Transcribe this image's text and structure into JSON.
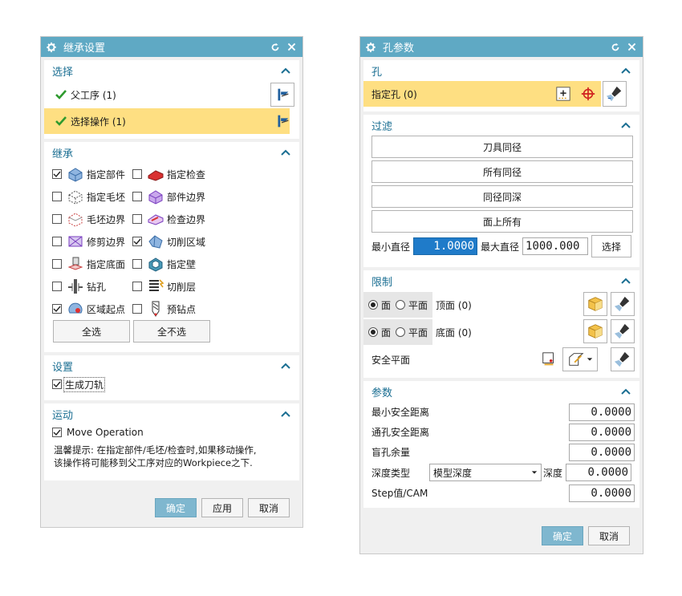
{
  "left": {
    "title": "继承设置",
    "select_section": {
      "title": "选择",
      "items": [
        {
          "label": "父工序 (1)",
          "highlighted": false
        },
        {
          "label": "选择操作 (1)",
          "highlighted": true
        }
      ]
    },
    "inherit_section": {
      "title": "继承",
      "left_col": [
        {
          "label": "指定部件",
          "checked": true,
          "icon": "part-icon"
        },
        {
          "label": "指定毛坯",
          "checked": false,
          "icon": "blank-icon"
        },
        {
          "label": "毛坯边界",
          "checked": false,
          "icon": "blank-boundary-icon"
        },
        {
          "label": "修剪边界",
          "checked": false,
          "icon": "trim-boundary-icon"
        },
        {
          "label": "指定底面",
          "checked": false,
          "icon": "floor-icon"
        },
        {
          "label": "钻孔",
          "checked": false,
          "icon": "drill-icon"
        },
        {
          "label": "区域起点",
          "checked": true,
          "icon": "region-start-icon"
        }
      ],
      "right_col": [
        {
          "label": "指定检查",
          "checked": false,
          "icon": "check-icon"
        },
        {
          "label": "部件边界",
          "checked": false,
          "icon": "part-boundary-icon"
        },
        {
          "label": "检查边界",
          "checked": false,
          "icon": "check-boundary-icon"
        },
        {
          "label": "切削区域",
          "checked": true,
          "icon": "cut-area-icon"
        },
        {
          "label": "指定壁",
          "checked": false,
          "icon": "wall-icon"
        },
        {
          "label": "切削层",
          "checked": false,
          "icon": "cut-levels-icon"
        },
        {
          "label": "预钻点",
          "checked": false,
          "icon": "predrill-icon"
        }
      ],
      "select_all": "全选",
      "deselect_all": "全不选"
    },
    "settings_section": {
      "title": "设置",
      "generate_path": {
        "label": "生成刀轨",
        "checked": true
      }
    },
    "motion_section": {
      "title": "运动",
      "move_operation": {
        "label": "Move Operation",
        "checked": true
      },
      "hint_line1": "温馨提示: 在指定部件/毛坯/检查时,如果移动操作,",
      "hint_line2": "该操作将可能移到父工序对应的Workpiece之下."
    },
    "buttons": {
      "ok": "确定",
      "apply": "应用",
      "cancel": "取消"
    }
  },
  "right": {
    "title": "孔参数",
    "hole_section": {
      "title": "孔",
      "specify_hole": "指定孔 (0)"
    },
    "filter_section": {
      "title": "过滤",
      "buttons": [
        "刀具同径",
        "所有同径",
        "同径同深",
        "面上所有"
      ],
      "min_dia_label": "最小直径",
      "min_dia_value": "1.0000",
      "max_dia_label": "最大直径",
      "max_dia_value": "1000.000",
      "select_label": "选择"
    },
    "limit_section": {
      "title": "限制",
      "top": {
        "face": "面",
        "plane": "平面",
        "label": "顶面 (0)"
      },
      "bottom": {
        "face": "面",
        "plane": "平面",
        "label": "底面 (0)"
      },
      "safe_plane": "安全平面"
    },
    "params_section": {
      "title": "参数",
      "rows": [
        {
          "label": "最小安全距离",
          "value": "0.0000"
        },
        {
          "label": "通孔安全距离",
          "value": "0.0000"
        },
        {
          "label": "盲孔余量",
          "value": "0.0000"
        }
      ],
      "depth_type_label": "深度类型",
      "depth_type_value": "模型深度",
      "depth_label": "深度",
      "depth_value": "0.0000",
      "step_label": "Step值/CAM",
      "step_value": "0.0000"
    },
    "buttons": {
      "ok": "确定",
      "cancel": "取消"
    }
  },
  "colors": {
    "title_bar": "#5fa9c4",
    "section_header": "#1a6e92",
    "highlight": "#fedf82",
    "ok_button": "#7fb7cf"
  }
}
